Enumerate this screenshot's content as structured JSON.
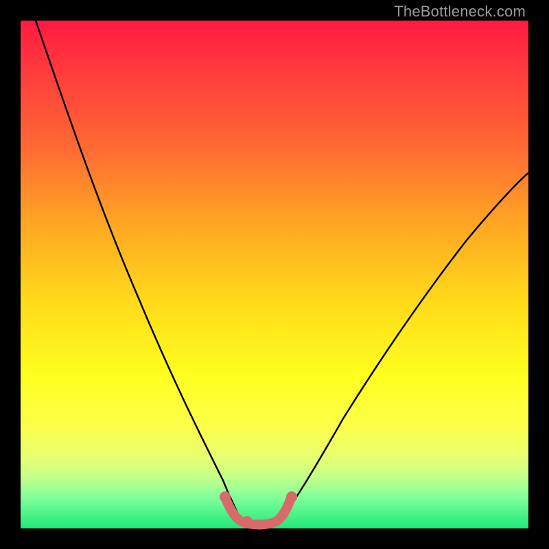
{
  "watermark": {
    "text": "TheBottleneck.com"
  },
  "colors": {
    "background_black": "#000000",
    "gradient_top": "#ff1a42",
    "gradient_mid1": "#ff6a33",
    "gradient_mid2": "#ffd91a",
    "gradient_mid3": "#ffff1f",
    "gradient_bottom": "#20e87a",
    "curve_stroke": "#000000",
    "flat_segment": "#d86a6a"
  },
  "chart_data": {
    "type": "line",
    "title": "",
    "xlabel": "",
    "ylabel": "",
    "xlim": [
      0,
      100
    ],
    "ylim": [
      0,
      100
    ],
    "series": [
      {
        "name": "left-curve",
        "x": [
          3,
          6,
          10,
          15,
          20,
          25,
          30,
          34,
          37,
          40,
          42
        ],
        "y": [
          100,
          90,
          78,
          64,
          50,
          38,
          26,
          17,
          10,
          5,
          2
        ]
      },
      {
        "name": "right-curve",
        "x": [
          50,
          53,
          57,
          62,
          68,
          75,
          83,
          92,
          100
        ],
        "y": [
          2,
          6,
          12,
          20,
          30,
          40,
          50,
          60,
          68
        ]
      },
      {
        "name": "flat-segment",
        "x": [
          40,
          42,
          44,
          46,
          48,
          50,
          52
        ],
        "y": [
          4,
          2,
          1.5,
          1.5,
          1.5,
          2,
          4
        ],
        "style": "thick-pink"
      }
    ],
    "notes": "V-shaped bottleneck curve; background heat gradient red→green; flat minimum band highlighted in salmon."
  }
}
